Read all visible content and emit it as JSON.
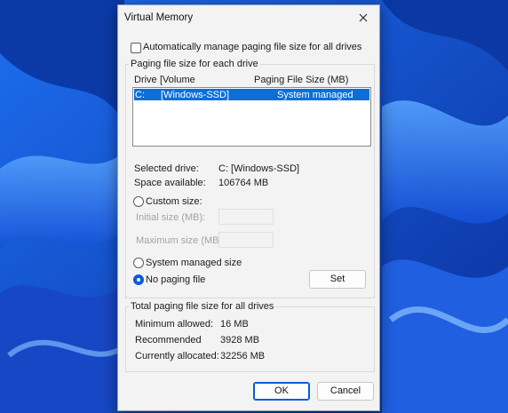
{
  "window": {
    "title": "Virtual Memory"
  },
  "auto_manage": {
    "label": "Automatically manage paging file size for all drives",
    "checked": false
  },
  "drives_group": {
    "caption": "Paging file size for each drive",
    "columns": {
      "drive": "Drive",
      "volume": "[Volume",
      "size": "Paging File Size (MB)"
    },
    "rows": [
      {
        "drive": "C:",
        "volume": "[Windows-SSD]",
        "size": "System managed",
        "selected": true
      }
    ],
    "selected_drive_label": "Selected drive:",
    "selected_drive_value": "C:  [Windows-SSD]",
    "space_available_label": "Space available:",
    "space_available_value": "106764 MB",
    "custom_size_label": "Custom size:",
    "initial_size_label": "Initial size (MB):",
    "maximum_size_label": "Maximum size (MB):",
    "system_managed_label": "System managed size",
    "no_paging_label": "No paging file",
    "selected_option": "no_paging",
    "set_button": "Set"
  },
  "totals_group": {
    "caption": "Total paging file size for all drives",
    "minimum_label": "Minimum allowed:",
    "minimum_value": "16 MB",
    "recommended_label": "Recommended",
    "recommended_value": "3928 MB",
    "allocated_label": "Currently allocated:",
    "allocated_value": "32256 MB"
  },
  "buttons": {
    "ok": "OK",
    "cancel": "Cancel"
  },
  "colors": {
    "accent": "#0b5cd6",
    "selection": "#0b6fd8",
    "wallpaper": "#0a3fb8"
  }
}
